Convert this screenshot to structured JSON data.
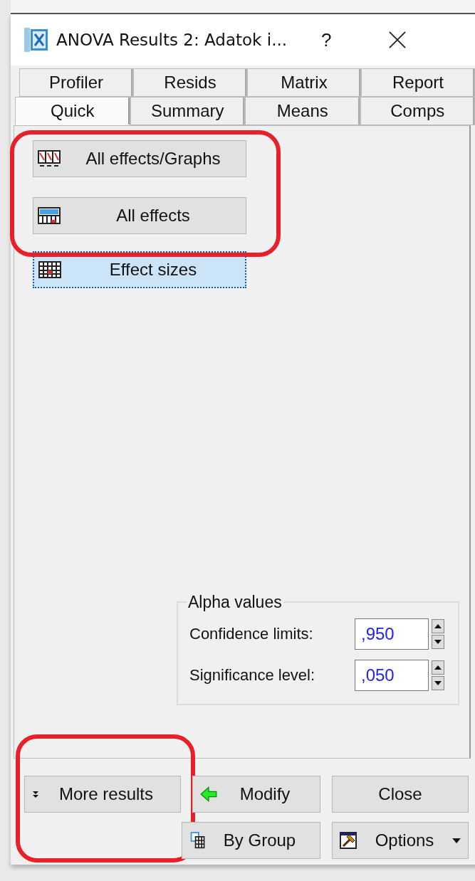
{
  "window": {
    "title": "ANOVA Results 2: Adatok i...",
    "help": "?"
  },
  "tab_rows": [
    [
      {
        "label": "Profiler",
        "selected": false
      },
      {
        "label": "Resids",
        "selected": false
      },
      {
        "label": "Matrix",
        "selected": false
      },
      {
        "label": "Report",
        "selected": false
      }
    ],
    [
      {
        "label": "Quick",
        "selected": true
      },
      {
        "label": "Summary",
        "selected": false
      },
      {
        "label": "Means",
        "selected": false
      },
      {
        "label": "Comps",
        "selected": false
      }
    ]
  ],
  "result_buttons": [
    {
      "label": "All effects/Graphs",
      "kind": "graphs",
      "highlighted": true,
      "focused": false
    },
    {
      "label": "All effects",
      "kind": "summary",
      "highlighted": true,
      "focused": false
    },
    {
      "label": "Effect sizes",
      "kind": "table",
      "highlighted": false,
      "focused": true
    }
  ],
  "alpha_group": {
    "title": "Alpha values",
    "fields": [
      {
        "label": "Confidence limits:",
        "value": ",950"
      },
      {
        "label": "Significance level:",
        "value": ",050"
      }
    ]
  },
  "footer_buttons": [
    {
      "label": "More results",
      "kind": "more",
      "highlighted": true
    },
    {
      "label": "Modify",
      "kind": "modify",
      "highlighted": false
    },
    {
      "label": "Close",
      "kind": "close",
      "highlighted": false
    },
    {
      "label": "By Group",
      "kind": "bygroup",
      "highlighted": false
    },
    {
      "label": "Options",
      "kind": "options",
      "highlighted": false
    }
  ]
}
